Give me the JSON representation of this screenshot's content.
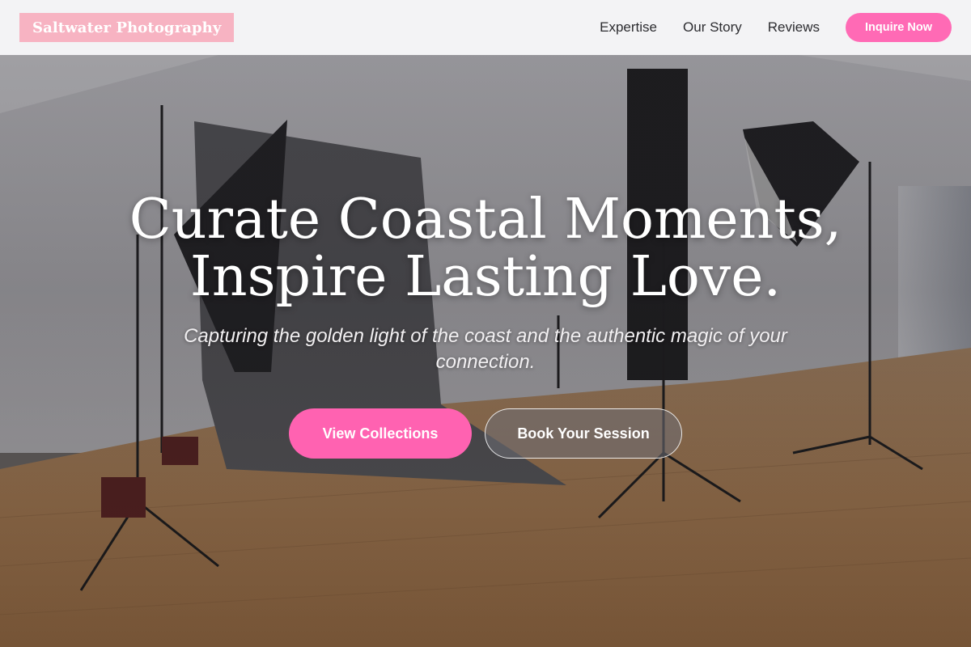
{
  "header": {
    "brand": "Saltwater Photography",
    "nav": [
      "Expertise",
      "Our Story",
      "Reviews"
    ],
    "cta": "Inquire Now"
  },
  "hero": {
    "headline_line1": "Curate Coastal Moments,",
    "headline_line2": "Inspire Lasting Love.",
    "subtitle": "Capturing the golden light of the coast and the authentic magic of your connection.",
    "primary_button": "View Collections",
    "secondary_button": "Book Your Session",
    "background_image": "photo-studio-lights-icon"
  },
  "colors": {
    "accent_pink": "#ff62b1",
    "brand_badge": "#f7b3c2",
    "header_bg": "#f6f6f8",
    "text_white": "#ffffff"
  }
}
